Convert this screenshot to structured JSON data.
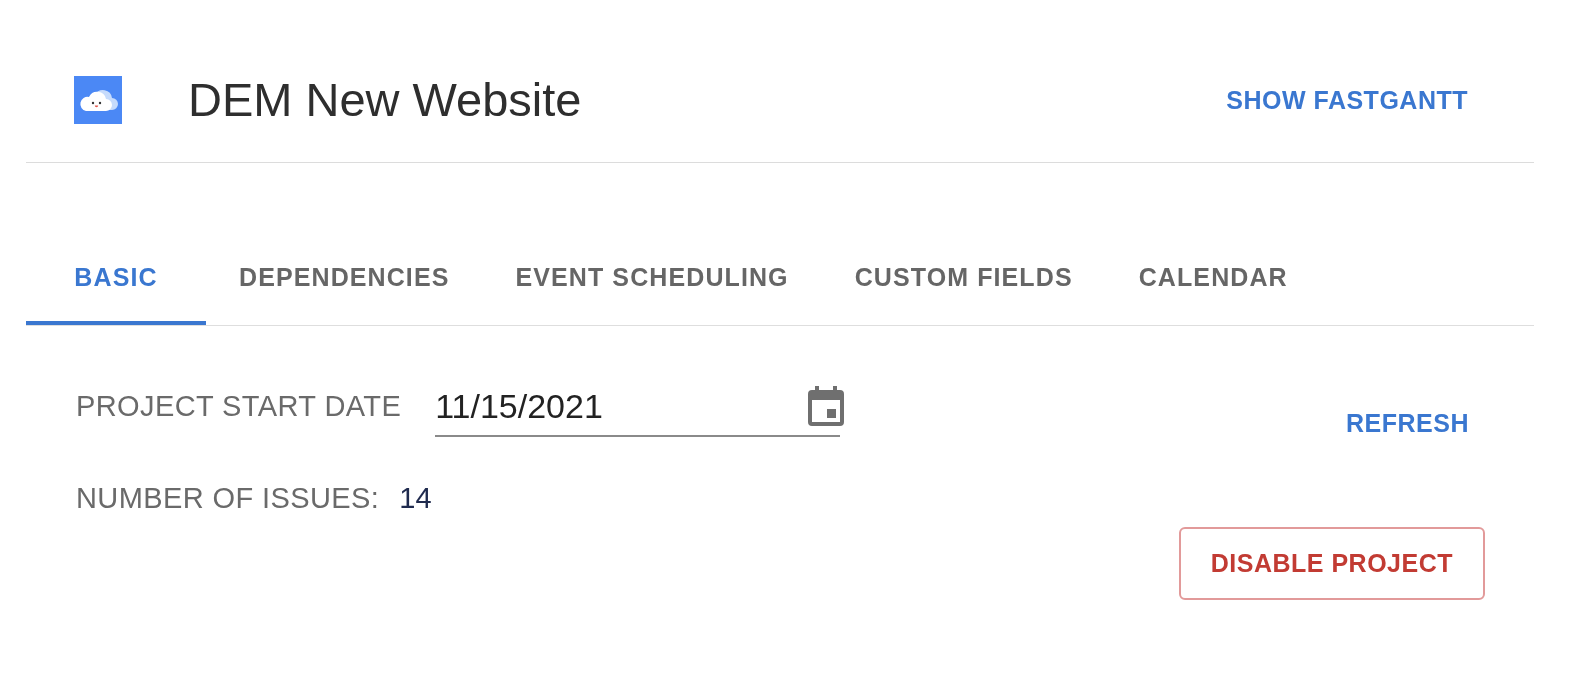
{
  "header": {
    "title": "DEM New Website",
    "action": "SHOW FASTGANTT"
  },
  "tabs": [
    {
      "label": "BASIC",
      "selected": true
    },
    {
      "label": "DEPENDENCIES",
      "selected": false
    },
    {
      "label": "EVENT SCHEDULING",
      "selected": false
    },
    {
      "label": "CUSTOM FIELDS",
      "selected": false
    },
    {
      "label": "CALENDAR",
      "selected": false
    }
  ],
  "form": {
    "start_date": {
      "label": "PROJECT START DATE",
      "value": "11/15/2021"
    },
    "issues": {
      "label": "NUMBER OF ISSUES:",
      "value": "14"
    }
  },
  "actions": {
    "refresh": "REFRESH",
    "disable": "DISABLE PROJECT"
  }
}
